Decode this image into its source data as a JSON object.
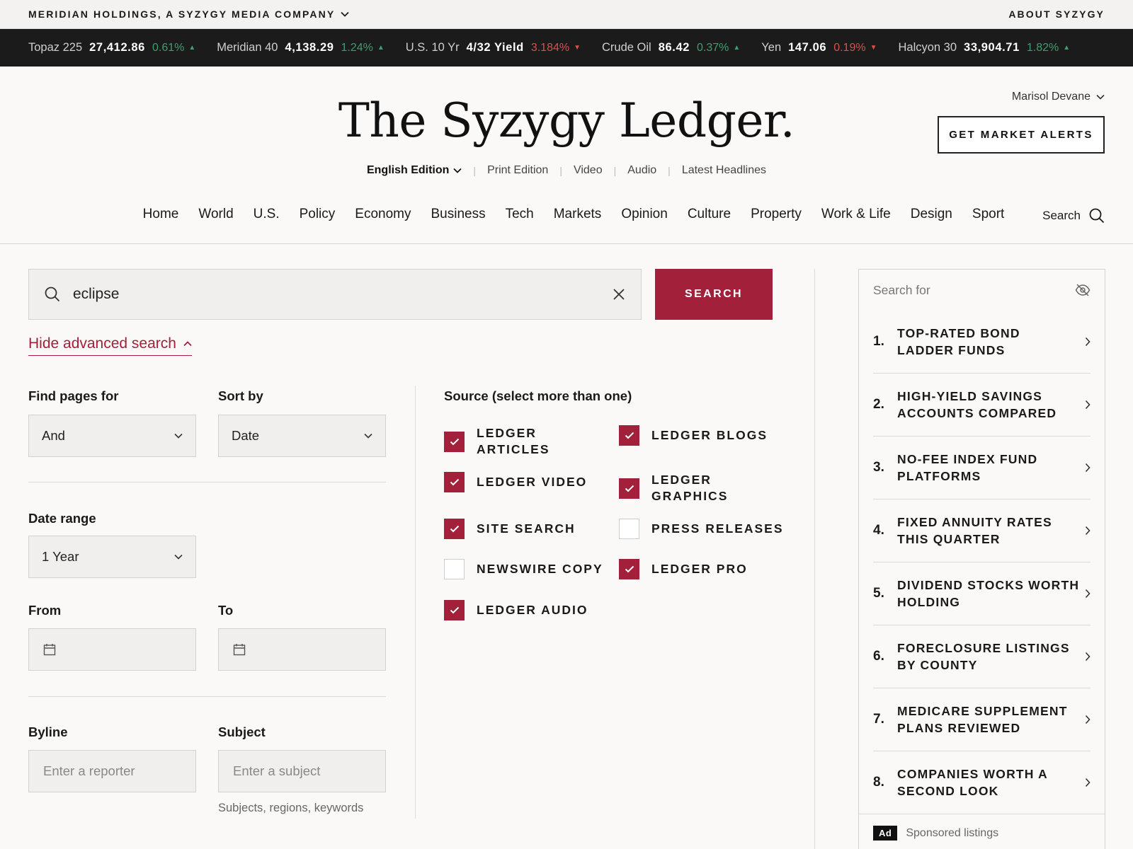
{
  "corp": {
    "name": "MERIDIAN HOLDINGS, A SYZYGY MEDIA COMPANY",
    "about": "ABOUT SYZYGY"
  },
  "ticker": [
    {
      "name": "Topaz 225",
      "value": "27,412.86",
      "change": "0.61%",
      "dir": "up"
    },
    {
      "name": "Meridian 40",
      "value": "4,138.29",
      "change": "1.24%",
      "dir": "up"
    },
    {
      "name": "U.S. 10 Yr",
      "value": "4/32 Yield",
      "change": "3.184%",
      "dir": "down"
    },
    {
      "name": "Crude Oil",
      "value": "86.42",
      "change": "0.37%",
      "dir": "up"
    },
    {
      "name": "Yen",
      "value": "147.06",
      "change": "0.19%",
      "dir": "down"
    },
    {
      "name": "Halcyon 30",
      "value": "33,904.71",
      "change": "1.82%",
      "dir": "up"
    }
  ],
  "masthead": {
    "logo": "The Syzygy Ledger.",
    "user": "Marisol Devane",
    "alerts_label": "GET MARKET ALERTS",
    "edition": "English Edition",
    "links": [
      "Print Edition",
      "Video",
      "Audio",
      "Latest Headlines"
    ]
  },
  "nav": {
    "items": [
      "Home",
      "World",
      "U.S.",
      "Policy",
      "Economy",
      "Business",
      "Tech",
      "Markets",
      "Opinion",
      "Culture",
      "Property",
      "Work & Life",
      "Design",
      "Sport"
    ],
    "search_label": "Search"
  },
  "search": {
    "query": "eclipse",
    "button": "SEARCH",
    "advanced_toggle": "Hide advanced search"
  },
  "filters": {
    "find_pages_label": "Find pages for",
    "find_pages_value": "And",
    "sort_label": "Sort by",
    "sort_value": "Date",
    "date_range_label": "Date range",
    "date_range_value": "1 Year",
    "from_label": "From",
    "to_label": "To",
    "byline_label": "Byline",
    "byline_placeholder": "Enter a reporter",
    "subject_label": "Subject",
    "subject_placeholder": "Enter a subject",
    "subject_hint": "Subjects, regions, keywords"
  },
  "sources": {
    "title": "Source (select more than one)",
    "items": [
      {
        "label": "LEDGER ARTICLES",
        "checked": true
      },
      {
        "label": "LEDGER BLOGS",
        "checked": true
      },
      {
        "label": "LEDGER VIDEO",
        "checked": true
      },
      {
        "label": "LEDGER GRAPHICS",
        "checked": true
      },
      {
        "label": "SITE SEARCH",
        "checked": true
      },
      {
        "label": "PRESS RELEASES",
        "checked": false
      },
      {
        "label": "NEWSWIRE COPY",
        "checked": false
      },
      {
        "label": "LEDGER PRO",
        "checked": true
      },
      {
        "label": "LEDGER AUDIO",
        "checked": true
      }
    ]
  },
  "sidebar": {
    "header": "Search for",
    "items": [
      {
        "num": "1.",
        "title": "TOP-RATED BOND LADDER FUNDS"
      },
      {
        "num": "2.",
        "title": "HIGH-YIELD SAVINGS ACCOUNTS COMPARED"
      },
      {
        "num": "3.",
        "title": "NO-FEE INDEX FUND PLATFORMS"
      },
      {
        "num": "4.",
        "title": "FIXED ANNUITY RATES THIS QUARTER"
      },
      {
        "num": "5.",
        "title": "DIVIDEND STOCKS WORTH HOLDING"
      },
      {
        "num": "6.",
        "title": "FORECLOSURE LISTINGS BY COUNTY"
      },
      {
        "num": "7.",
        "title": "MEDICARE SUPPLEMENT PLANS REVIEWED"
      },
      {
        "num": "8.",
        "title": "COMPANIES WORTH A SECOND LOOK"
      }
    ],
    "ad_badge": "Ad",
    "ad_text": "Sponsored listings"
  },
  "colors": {
    "accent": "#a3203a",
    "up": "#3f9e6e",
    "down": "#d9504a",
    "ticker_bg": "#1b1b1b"
  }
}
